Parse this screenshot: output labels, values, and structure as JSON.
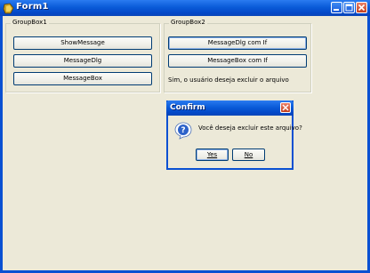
{
  "window": {
    "title": "Form1"
  },
  "groupbox1": {
    "label": "GroupBox1",
    "buttons": [
      "ShowMessage",
      "MessageDlg",
      "MessageBox"
    ]
  },
  "groupbox2": {
    "label": "GroupBox2",
    "buttons": [
      "MessageDlg com If",
      "MessageBox com If"
    ],
    "result_label": "Sim, o usuário deseja excluir o arquivo"
  },
  "dialog": {
    "title": "Confirm",
    "message": "Você deseja excluir este arquivo?",
    "yes_label": "Yes",
    "no_label": "No",
    "icon": "question-icon"
  },
  "colors": {
    "titlebar": "#0a5bd8",
    "face": "#ece9d8",
    "close": "#c3401f"
  }
}
